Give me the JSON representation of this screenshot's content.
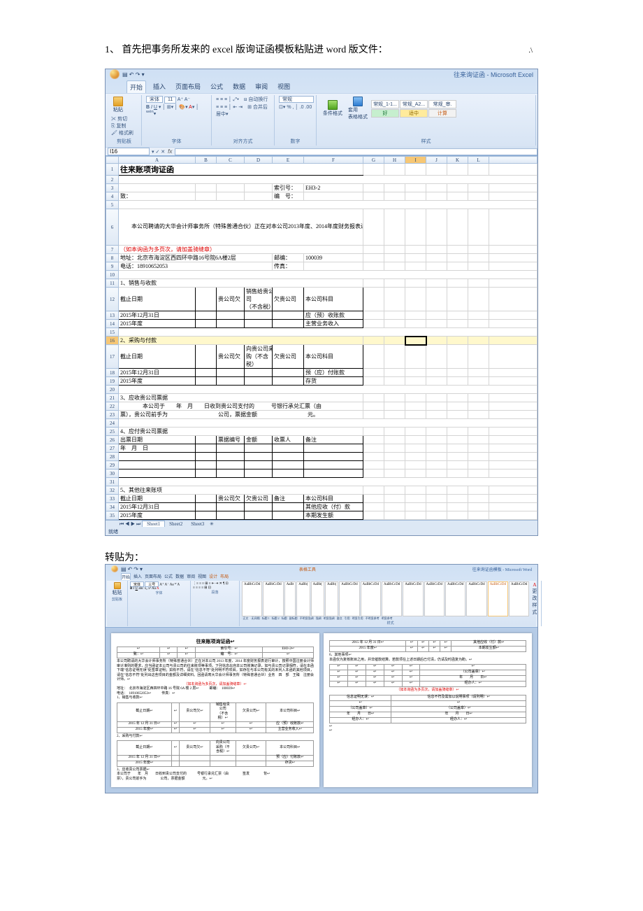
{
  "corner": ".\\",
  "instruction": "1、 首先把事务所发来的 excel 版询证函模板粘贴进 word 版文件：",
  "subInstruction": "转贴为：",
  "excel": {
    "winTitle": "往来询证函 - Microsoft Excel",
    "tabs": [
      "开始",
      "插入",
      "页面布局",
      "公式",
      "数据",
      "审阅",
      "视图"
    ],
    "contextTab": "",
    "clipboard": {
      "label": "剪贴板",
      "paste": "粘贴",
      "cut": "剪切",
      "copy": "复制",
      "format": "格式刷"
    },
    "fontGroup": {
      "label": "字体",
      "font": "宋体",
      "size": "11"
    },
    "alignGroup": {
      "label": "对齐方式",
      "wrap": "自动换行",
      "merge": "合并后居中"
    },
    "numberGroup": {
      "label": "数字",
      "format": "常规"
    },
    "stylesGroup": {
      "label": "样式",
      "cond": "条件格式",
      "table": "套用\n表格格式",
      "cells": [
        "常规_1-1...",
        "常规_A2...",
        "常规_审.",
        "好",
        "适中",
        "计算"
      ]
    },
    "cellName": "I16",
    "cols": [
      "",
      "A",
      "B",
      "C",
      "D",
      "E",
      "F",
      "G",
      "H",
      "I",
      "J",
      "K",
      "L",
      ""
    ],
    "title": "往来账项询证函",
    "r3_index": "索引号：",
    "r3_code": "EH3-2",
    "r4_a": "致：",
    "r4_index": "编　号：",
    "paragraph": "　　本公司聘请的大华会计师事务所（特殊普通合伙）正在对本公司2013年度、2014年度财务报表进行审计，按照中国注册会计师审计准则的要求，应当函证本公司与贵公司的往来账项等事项。下列信息出自本公司账簿记录，如与贵公司记录相符，请在本函下端\"信息证明无误\"处签章证明；如有不符，请在\"信息不符\"处列明不符项目。如存在与本公司有关的未列入本函的其他项目，请在\"信息不符\"处列出这些项目的金额及详细资料。回函请寄大华会计师事务所（特殊普通合伙）业务　四　部　王臻　注册会计师。",
    "note": "（如本询函为多页次，请加盖骑缝章）",
    "addr_label": "地址：",
    "addr": "北京市海淀区西四环中路16号院6A楼2层",
    "post_label": "邮编：",
    "post": "100039",
    "tel_label": "电话：",
    "tel": "18910652053",
    "fax_label": "传真：",
    "s1": "1、销售与收款",
    "t1h_date": "截止日期",
    "t1h_owe": "贵公司欠",
    "t1h_sold": "销售给贵公\n司\n（不含税）",
    "t1h_due": "欠贵公司",
    "t1h_subj": "本公司科目",
    "t1r1_date": "2015年12月31日",
    "t1r1_subj": "应（预）收账款",
    "t1r2_date": "2015年度",
    "t1r2_subj": "主营业务收入",
    "s2": "2、采购与付款",
    "t2h_date": "截止日期",
    "t2h_owe": "贵公司欠",
    "t2h_buy": "向贵公司采\n购（不含\n税）",
    "t2h_due": "欠贵公司",
    "t2h_subj": "本公司科目",
    "t2r1_date": "2015年12月31日",
    "t2r1_subj": "预（应）付账款",
    "t2r2_date": "2015年度",
    "t2r2_subj": "存货",
    "s3": "3、应收贵公司票据",
    "s3_l1": "　　　　本公司于　　年　月　　日收到贵公司支付的　　　号银行承兑汇票（由",
    "s3_l2": "票），贵公司前手为　　　　　　　　　公司，票据金额　　　　　　　　　元。",
    "s4": "4、应付贵公司票据",
    "t4h_date": "出票日期",
    "t4h_no": "票据编号",
    "t4h_amt": "金额",
    "t4h_payee": "收票人",
    "t4h_rem": "备注",
    "t4r1_date": "年　月　日",
    "s5": "5、其他往来账项",
    "t5h_date": "截止日期",
    "t5h_owe": "贵公司欠",
    "t5h_due": "欠贵公司",
    "t5h_rem": "备注",
    "t5h_subj": "本公司科目",
    "t5r1_date": "2015年12月31日",
    "t5r1_subj": "其他应收（付）款",
    "t5r2_date": "2015年度",
    "t5r2_subj": "本期发生额",
    "sheetTabs": [
      "Sheet1",
      "Sheet2",
      "Sheet3"
    ],
    "status": "就绪"
  },
  "word": {
    "winTitle": "往来询证函模板 - Microsoft Word",
    "contextTab": "表格工具",
    "tabs": [
      "开始",
      "插入",
      "页面布局",
      "公式",
      "数据",
      "审阅",
      "视图",
      "设计",
      "布局"
    ],
    "font": "宋体",
    "size": "三号",
    "styles": [
      "AaBbCcDd",
      "AaBbCcDd",
      "AaBt",
      "AaBb(",
      "AaBb(",
      "AaBb(",
      "AaBbCcDd",
      "AaBbCcDd",
      "AaBbCcDd",
      "AaBbCcDd",
      "AaBbCcDd",
      "AaBbCcDd",
      "AaBbCcDd",
      "AaBbCcDd",
      "AaBbCcDd"
    ],
    "styleLabels": [
      "·正文",
      "·无间隔",
      "标题 1",
      "标题 2",
      "标题",
      " 副标题",
      "不明显强调",
      "强调",
      "明显强调",
      "要点",
      "引用",
      "明显引用",
      "不明显参考",
      "明显参考"
    ],
    "changeStyle": "更改样式",
    "groups": [
      "剪贴板",
      "字体",
      "段落",
      "样式"
    ],
    "p1": {
      "title": "往来账项询证函↩",
      "idx": "索引号：↩",
      "code": "EH3-2↩",
      "num": "编　号：↩",
      "to": "致：↩",
      "para": "本公司聘请的大华会计师事务所（特殊普通合伙）正在对本公司 2013 年度、2014 年度财务报表进行审计，按照中国注册会计师审计准则的要求，应当函证本公司与贵公司的往来账项等事项。下列信息出自本公司账簿记录，如与贵公司记录相符，请在本函下端\"信息证明无误\"处签章证明；如有不符，请在\"信息不符\"处列明不符项目。如存在与本公司有关的未列入本函的其他项目，请在\"信息不符\"处列出这些项目的金额及详细资料。回函请寄大华会计师事务所（特殊普通合伙）业务　四　部　王臻　注册会计师。↩",
      "note": "（如本询函为多页次，请加盖骑缝章）↩",
      "addr": "地址：　北京市海淀区西四环中路 16 号院 6A 楼 2 层↩",
      "post": "邮编：　100039↩",
      "tel": "电话：　18910652053↩",
      "fax": "传真：↩",
      "s1": "1、销售与收款↩",
      "th": [
        "截止日期↩",
        "↩",
        "贵公司欠↩",
        "销售给贵\n公司\n（不含\n税）↩",
        "欠贵公司↩",
        "本公司科目↩"
      ],
      "r1": [
        "2015 年 12 月 31 日↩",
        "↩",
        "↩",
        "↩",
        "↩",
        "应（预）收账款↩"
      ],
      "r2": [
        "2015 年度↩",
        "↩",
        "↩",
        "↩",
        "↩",
        "主营业务收入↩"
      ],
      "s2": "2、采购与付款↩",
      "th2": [
        "截止日期↩",
        "↩",
        "贵公司欠↩",
        "向贵公司\n采购（不\n含税）↩",
        "欠贵公司↩",
        "本公司科目↩"
      ],
      "r21": [
        "2015 年 12 月 31 日↩",
        "",
        "",
        "",
        "",
        "预（应）付账款↩"
      ],
      "r22": [
        "2015 年度↩",
        "",
        "",
        "",
        "",
        "存货↩"
      ],
      "s3": "3、应收贵公司票据↩",
      "s3t": "本公司于　　年　月　　日收到贵公司支付的　　　号银行承兑汇票（由　　　　签发　　　　背↩",
      "s3t2": "票），贵公司前手为　　　　公司，票据金额　　　　　元。↩"
    },
    "p2": {
      "r1": [
        "2015 年 12 月 31 日↩",
        "↩",
        "↩",
        "↩",
        "↩",
        "其他应收（付）款↩"
      ],
      "r2": [
        "2015 年度↩",
        "↩",
        "↩",
        "↩",
        "↩",
        "本期发生额↩"
      ],
      "s6": "6、其他事项↩",
      "s6t": "本函仅为复核账目之用，并非催款结算。若款项在上述日期后已付清，仍请及时函复为盼。↩",
      "seal": "（公司盖章）↩",
      "date_line": "年　　月　　日↩",
      "jbr": "经办人：↩",
      "note": "（如本询函为多页次，请加盖骑缝章）↩",
      "conf": "信息证明无误：↩",
      "wrong": "信息不符及需加以说明事项（请列明）↩"
    }
  }
}
